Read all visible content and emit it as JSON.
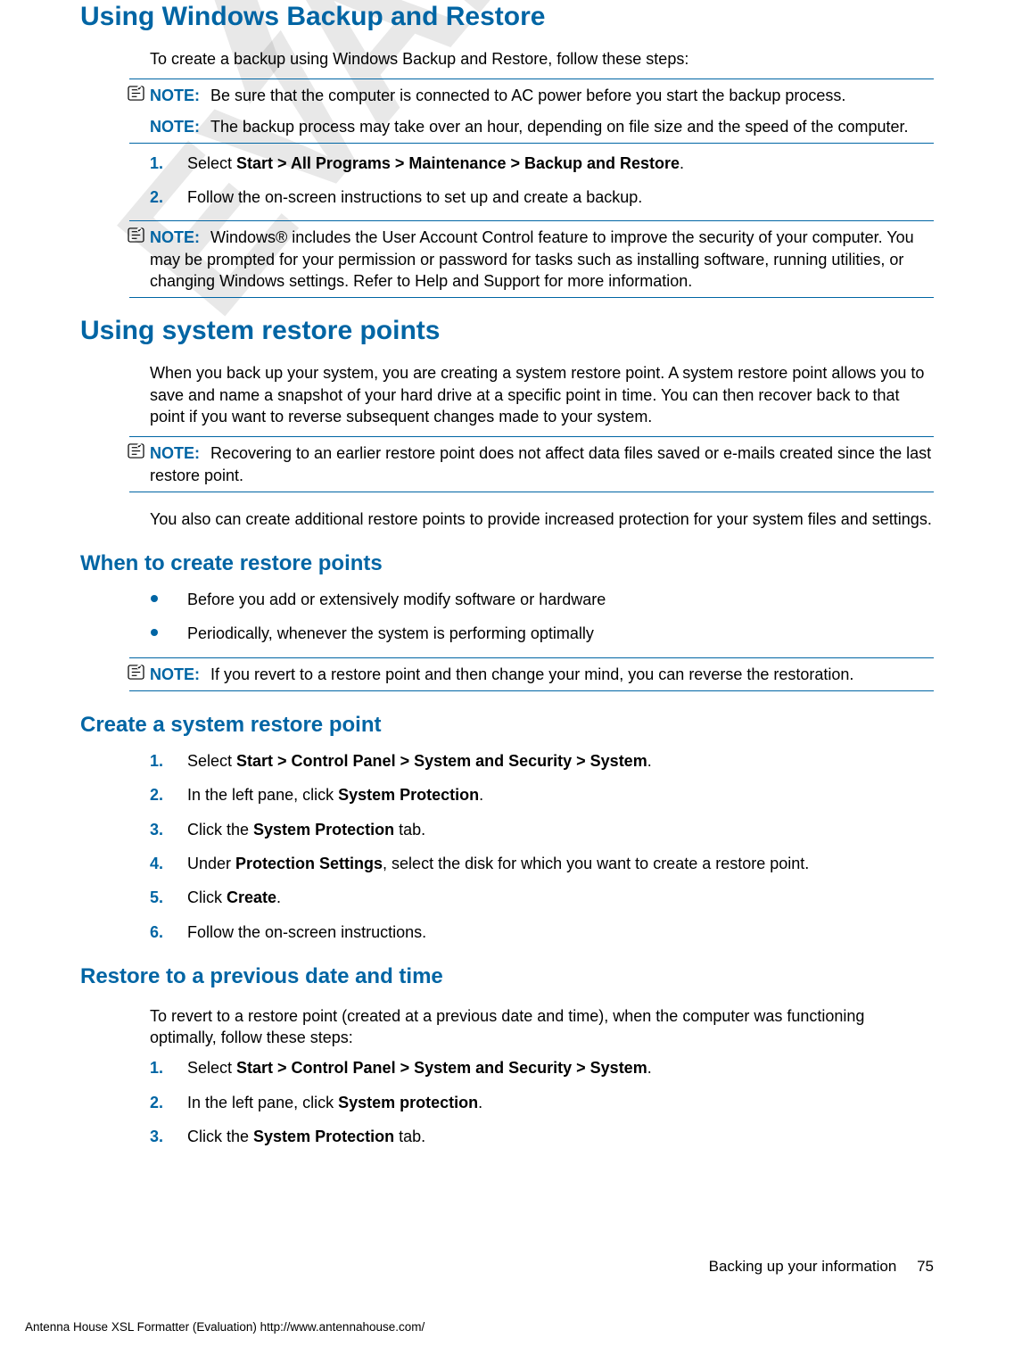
{
  "watermark": {
    "line1": "XSL Formatter",
    "line2": "EVALUATION"
  },
  "sections": {
    "s1": {
      "title": "Using Windows Backup and Restore",
      "intro": "To create a backup using Windows Backup and Restore, follow these steps:",
      "note1": {
        "label": "NOTE:",
        "text": "Be sure that the computer is connected to AC power before you start the backup process."
      },
      "note2": {
        "label": "NOTE:",
        "text": "The backup process may take over an hour, depending on file size and the speed of the computer."
      },
      "steps": [
        {
          "num": "1.",
          "pre": "Select ",
          "bold": "Start > All Programs > Maintenance > Backup and Restore",
          "post": "."
        },
        {
          "num": "2.",
          "pre": "Follow the on-screen instructions to set up and create a backup.",
          "bold": "",
          "post": ""
        }
      ],
      "note3": {
        "label": "NOTE:",
        "text": "Windows® includes the User Account Control feature to improve the security of your computer. You may be prompted for your permission or password for tasks such as installing software, running utilities, or changing Windows settings. Refer to Help and Support for more information."
      }
    },
    "s2": {
      "title": "Using system restore points",
      "p1": "When you back up your system, you are creating a system restore point. A system restore point allows you to save and name a snapshot of your hard drive at a specific point in time. You can then recover back to that point if you want to reverse subsequent changes made to your system.",
      "note1": {
        "label": "NOTE:",
        "text": "Recovering to an earlier restore point does not affect data files saved or e-mails created since the last restore point."
      },
      "p2": "You also can create additional restore points to provide increased protection for your system files and settings."
    },
    "s3": {
      "title": "When to create restore points",
      "bullets": [
        "Before you add or extensively modify software or hardware",
        "Periodically, whenever the system is performing optimally"
      ],
      "note1": {
        "label": "NOTE:",
        "text": "If you revert to a restore point and then change your mind, you can reverse the restoration."
      }
    },
    "s4": {
      "title": "Create a system restore point",
      "steps": [
        {
          "num": "1.",
          "pre": "Select ",
          "bold": "Start > Control Panel > System and Security > System",
          "post": "."
        },
        {
          "num": "2.",
          "pre": "In the left pane, click ",
          "bold": "System Protection",
          "post": "."
        },
        {
          "num": "3.",
          "pre": "Click the ",
          "bold": "System Protection",
          "post": " tab."
        },
        {
          "num": "4.",
          "pre": "Under ",
          "bold": "Protection Settings",
          "post": ", select the disk for which you want to create a restore point."
        },
        {
          "num": "5.",
          "pre": "Click ",
          "bold": "Create",
          "post": "."
        },
        {
          "num": "6.",
          "pre": "Follow the on-screen instructions.",
          "bold": "",
          "post": ""
        }
      ]
    },
    "s5": {
      "title": "Restore to a previous date and time",
      "p1": "To revert to a restore point (created at a previous date and time), when the computer was functioning optimally, follow these steps:",
      "steps": [
        {
          "num": "1.",
          "pre": "Select ",
          "bold": "Start > Control Panel > System and Security > System",
          "post": "."
        },
        {
          "num": "2.",
          "pre": "In the left pane, click ",
          "bold": "System protection",
          "post": "."
        },
        {
          "num": "3.",
          "pre": "Click the ",
          "bold": "System Protection",
          "post": " tab."
        }
      ]
    }
  },
  "footer": {
    "text": "Backing up your information",
    "page": "75"
  },
  "generator": "Antenna House XSL Formatter (Evaluation)  http://www.antennahouse.com/"
}
